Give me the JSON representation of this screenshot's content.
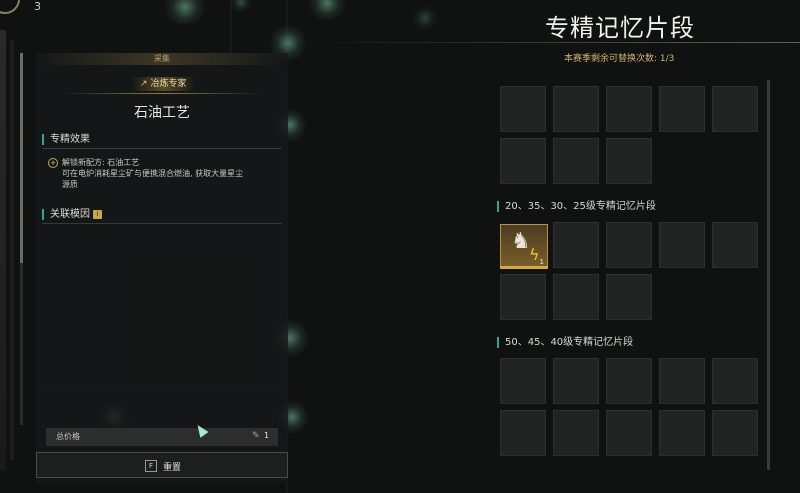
{
  "topbar": {
    "index": "3"
  },
  "left_panel": {
    "category": "采集",
    "role": "冶炼专家",
    "skill_title": "石油工艺",
    "effect_section": "专精效果",
    "effect_lines": [
      "解锁新配方: 石油工艺",
      "可在电炉消耗星尘矿与便携混合燃油, 获取大量星尘",
      "源质"
    ],
    "gene_section": "关联模因",
    "gene_badge": "i",
    "price_label": "总价格",
    "price_value": "1",
    "reset_key": "F",
    "reset_label": "重置"
  },
  "right_panel": {
    "title": "专精记忆片段",
    "swap_info": "本赛季剩余可替换次数: 1/3",
    "group1_label": "20、35、30、25级专精记忆片段",
    "group2_label": "50、45、40级专精记忆片段",
    "item_count": "1"
  },
  "colors": {
    "accent_gold": "#d2b46a",
    "accent_teal": "#3aa090",
    "background": "#101111"
  },
  "icons": [
    "wrench-icon",
    "effect-plus-icon",
    "info-icon",
    "gem-icon",
    "key-f-icon",
    "robot-figure-icon",
    "lightning-icon",
    "cursor-icon"
  ]
}
